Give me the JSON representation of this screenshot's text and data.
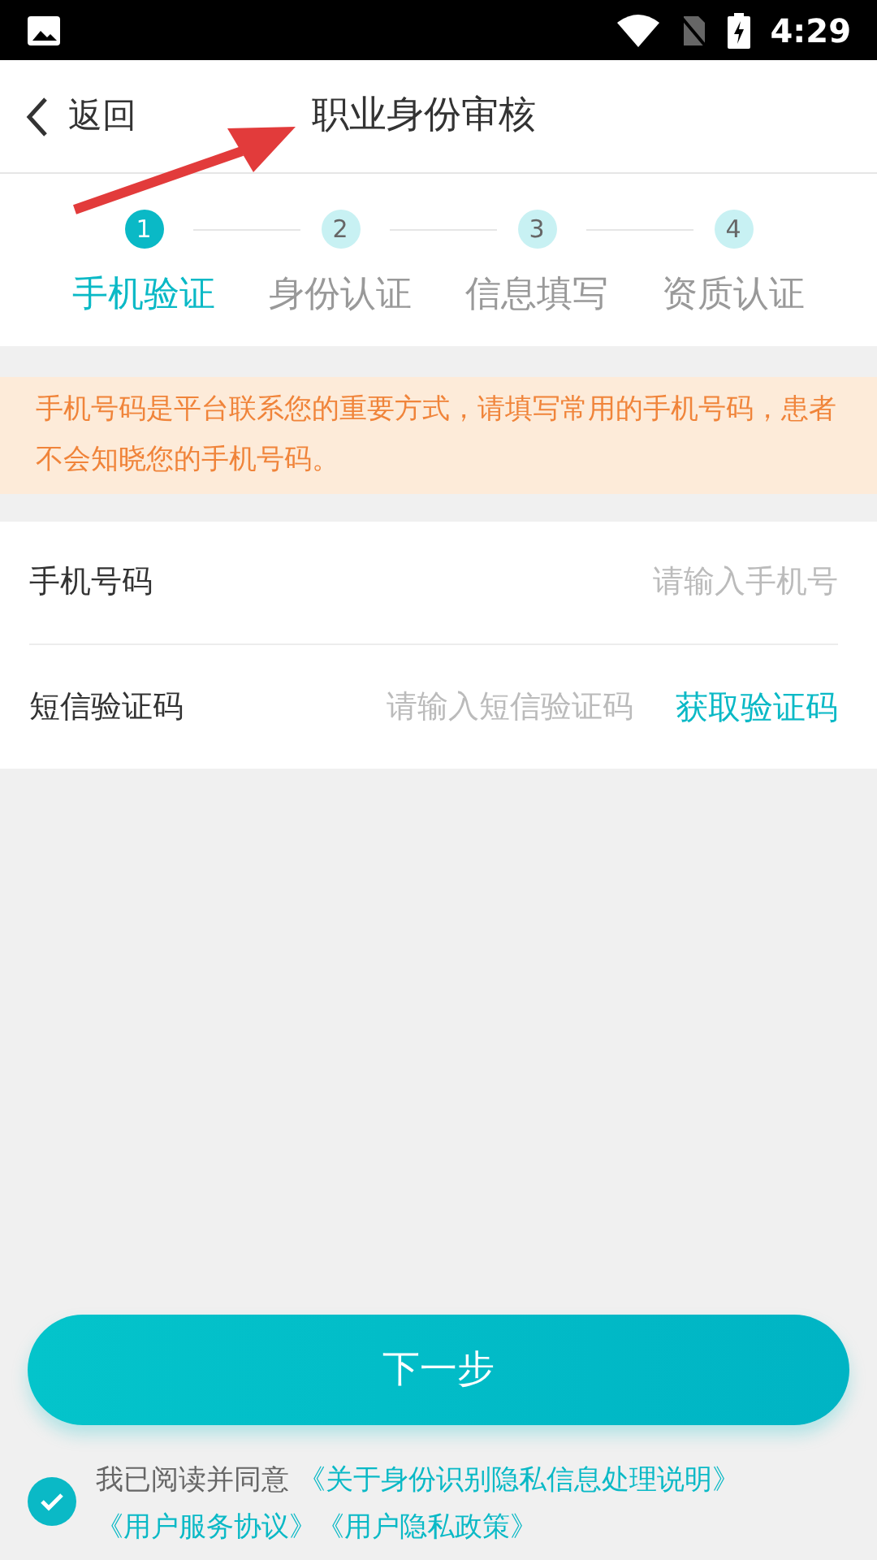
{
  "status_bar": {
    "time": "4:29"
  },
  "header": {
    "back": "返回",
    "title": "职业身份审核"
  },
  "steps": [
    {
      "number": "1",
      "label": "手机验证",
      "selected": true
    },
    {
      "number": "2",
      "label": "身份认证",
      "selected": false
    },
    {
      "number": "3",
      "label": "信息填写",
      "selected": false
    },
    {
      "number": "4",
      "label": "资质认证",
      "selected": false
    }
  ],
  "notice": "手机号码是平台联系您的重要方式，请填写常用的手机号码，患者不会知晓您的手机号码。",
  "form": [
    {
      "kind": "phone",
      "label": "手机号码",
      "placeholder": "请输入手机号"
    },
    {
      "kind": "code",
      "label": "短信验证码",
      "placeholder": "请输入短信验证码",
      "action": "获取验证码"
    }
  ],
  "next_button": "下一步",
  "agreement": {
    "checked": true,
    "text": "我已阅读并同意",
    "links": [
      "《关于身份识别隐私信息处理说明》",
      "《用户服务协议》",
      "《用户隐私政策》"
    ]
  }
}
